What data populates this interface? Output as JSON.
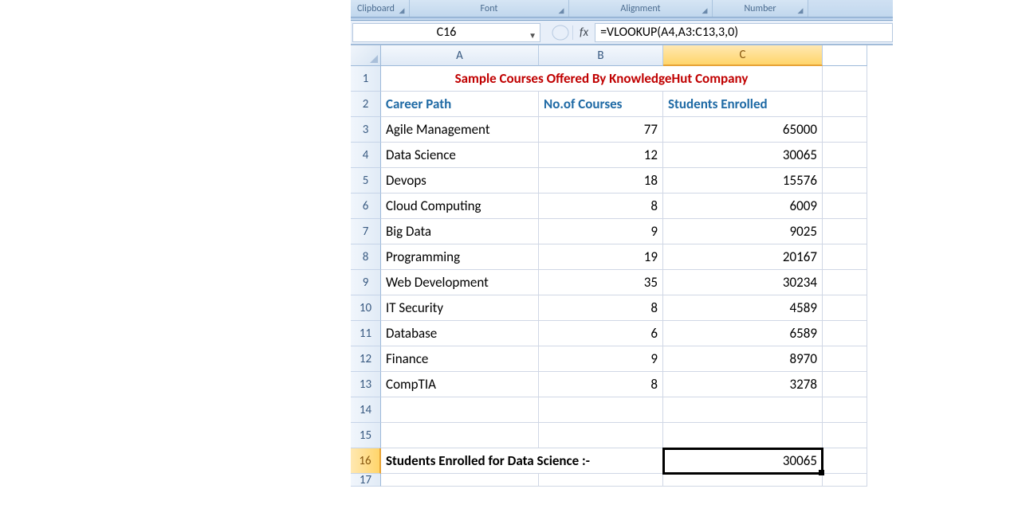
{
  "ribbon": {
    "clipboard": "Clipboard",
    "font": "Font",
    "alignment": "Alignment",
    "number": "Number"
  },
  "nameBox": "C16",
  "fxLabel": "fx",
  "formula": "=VLOOKUP(A4,A3:C13,3,0)",
  "columns": [
    "A",
    "B",
    "C"
  ],
  "rows": [
    "1",
    "2",
    "3",
    "4",
    "5",
    "6",
    "7",
    "8",
    "9",
    "10",
    "11",
    "12",
    "13",
    "14",
    "15",
    "16",
    "17"
  ],
  "title": "Sample Courses Offered By KnowledgeHut Company",
  "headers": {
    "a": "Career Path",
    "b": "No.of Courses",
    "c": "Students Enrolled"
  },
  "data": [
    {
      "path": "Agile Management",
      "courses": "77",
      "students": "65000"
    },
    {
      "path": "Data Science",
      "courses": "12",
      "students": "30065"
    },
    {
      "path": "Devops",
      "courses": "18",
      "students": "15576"
    },
    {
      "path": "Cloud Computing",
      "courses": "8",
      "students": "6009"
    },
    {
      "path": "Big Data",
      "courses": "9",
      "students": "9025"
    },
    {
      "path": "Programming",
      "courses": "19",
      "students": "20167"
    },
    {
      "path": "Web Development",
      "courses": "35",
      "students": "30234"
    },
    {
      "path": "IT Security",
      "courses": "8",
      "students": "4589"
    },
    {
      "path": "Database",
      "courses": "6",
      "students": "6589"
    },
    {
      "path": "Finance",
      "courses": "9",
      "students": "8970"
    },
    {
      "path": "CompTIA",
      "courses": "8",
      "students": "3278"
    }
  ],
  "result": {
    "label": "Students Enrolled for Data Science :-",
    "value": "30065"
  }
}
